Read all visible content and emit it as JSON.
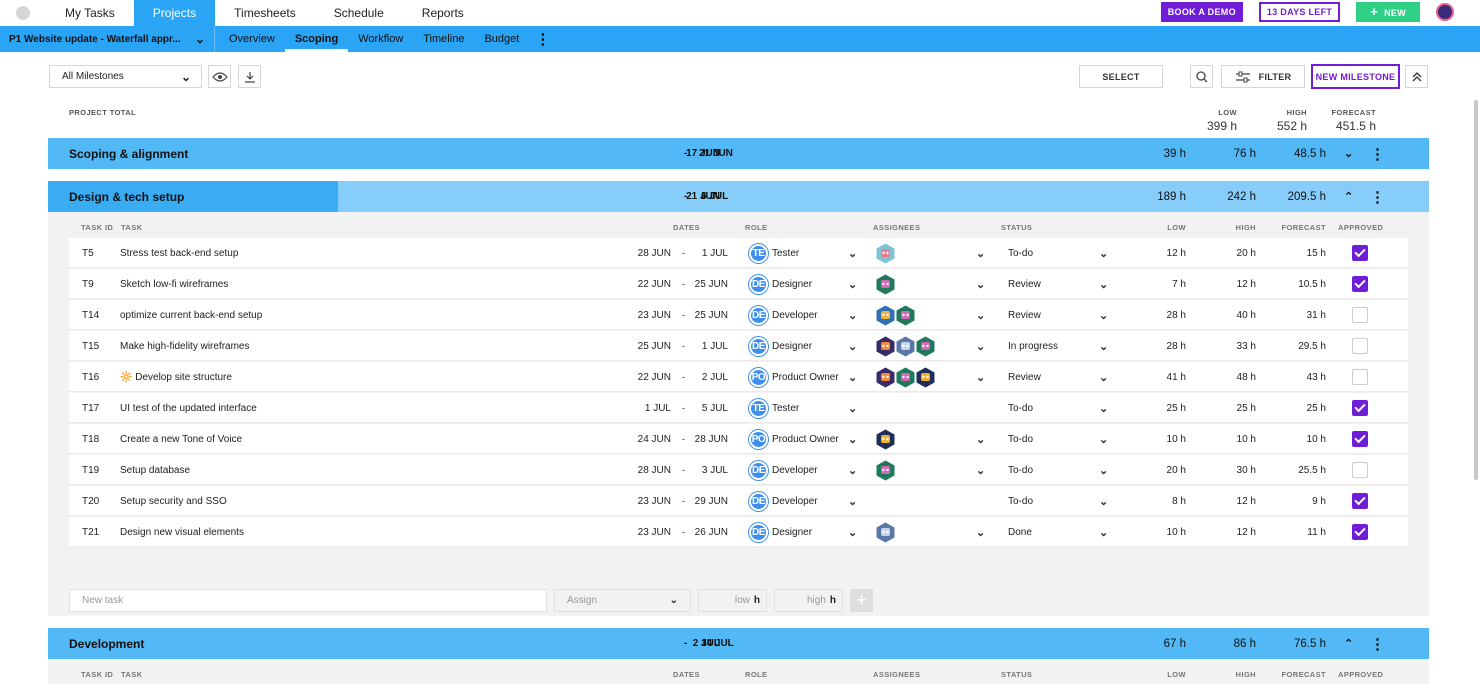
{
  "nav": {
    "items": [
      "My Tasks",
      "Projects",
      "Timesheets",
      "Schedule",
      "Reports"
    ],
    "active_index": 1,
    "book_demo": "BOOK A DEMO",
    "days_left": "13 DAYS LEFT",
    "new": "NEW"
  },
  "subnav": {
    "project": "P1  Website update - Waterfall appr...",
    "tabs": [
      "Overview",
      "Scoping",
      "Workflow",
      "Timeline",
      "Budget"
    ],
    "active_index": 1
  },
  "toolbar": {
    "milestone_filter": "All Milestones",
    "select": "SELECT",
    "filter": "FILTER",
    "new_milestone": "NEW MILESTONE"
  },
  "totals": {
    "label": "PROJECT TOTAL",
    "low_label": "LOW",
    "high_label": "HIGH",
    "forecast_label": "FORECAST",
    "low": "399 h",
    "high": "552 h",
    "forecast": "451.5 h"
  },
  "milestones": [
    {
      "name": "Scoping & alignment",
      "start": "17 JUN",
      "end": "21 JUN",
      "low": "39 h",
      "high": "76 h",
      "forecast": "48.5 h",
      "progress": 1.0
    },
    {
      "name": "Design & tech setup",
      "start": "21 JUN",
      "end": "6 JUL",
      "low": "189 h",
      "high": "242 h",
      "forecast": "209.5 h",
      "progress": 0.21
    },
    {
      "name": "Development",
      "start": "2 JUL",
      "end": "14 JUL",
      "low": "67 h",
      "high": "86 h",
      "forecast": "76.5 h",
      "progress": 1.0
    }
  ],
  "headers": {
    "task_id": "TASK ID",
    "task": "TASK",
    "dates": "DATES",
    "role": "ROLE",
    "assignees": "ASSIGNEES",
    "status": "STATUS",
    "low": "LOW",
    "high": "HIGH",
    "forecast": "FORECAST",
    "approved": "APPROVED"
  },
  "dash": "-",
  "tasks": [
    {
      "id": "T5",
      "task": "Stress test back-end setup",
      "start": "28 JUN",
      "end": "1 JUL",
      "role_abbr": "TE",
      "role": "Tester",
      "assignees": [
        "robot-pink"
      ],
      "status": "To-do",
      "low": "12 h",
      "high": "20 h",
      "forecast": "15 h",
      "approved": true
    },
    {
      "id": "T9",
      "task": "Sketch low-fi wireframes",
      "start": "22 JUN",
      "end": "25 JUN",
      "role_abbr": "DE",
      "role": "Designer",
      "assignees": [
        "robot-green"
      ],
      "status": "Review",
      "low": "7 h",
      "high": "12 h",
      "forecast": "10.5 h",
      "approved": true
    },
    {
      "id": "T14",
      "task": "optimize current back-end setup",
      "start": "23 JUN",
      "end": "25 JUN",
      "role_abbr": "DE",
      "role": "Developer",
      "assignees": [
        "robot-blue",
        "robot-green"
      ],
      "status": "Review",
      "low": "28 h",
      "high": "40 h",
      "forecast": "31 h",
      "approved": false
    },
    {
      "id": "T15",
      "task": "Make high-fidelity wireframes",
      "start": "25 JUN",
      "end": "1 JUL",
      "role_abbr": "DE",
      "role": "Designer",
      "assignees": [
        "robot-purple",
        "robot-grey",
        "robot-green"
      ],
      "status": "In progress",
      "low": "28 h",
      "high": "33 h",
      "forecast": "29.5 h",
      "approved": false
    },
    {
      "id": "T16",
      "task": "🔆 Develop site structure",
      "start": "22 JUN",
      "end": "2 JUL",
      "role_abbr": "PO",
      "role": "Product Owner",
      "assignees": [
        "robot-purple",
        "robot-green",
        "robot-navy"
      ],
      "status": "Review",
      "low": "41 h",
      "high": "48 h",
      "forecast": "43 h",
      "approved": false
    },
    {
      "id": "T17",
      "task": "UI test of the updated interface",
      "start": "1 JUL",
      "end": "5 JUL",
      "role_abbr": "TE",
      "role": "Tester",
      "assignees": [],
      "status": "To-do",
      "low": "25 h",
      "high": "25 h",
      "forecast": "25 h",
      "approved": true
    },
    {
      "id": "T18",
      "task": "Create a new Tone of Voice",
      "start": "24 JUN",
      "end": "28 JUN",
      "role_abbr": "PO",
      "role": "Product Owner",
      "assignees": [
        "robot-navy"
      ],
      "status": "To-do",
      "low": "10 h",
      "high": "10 h",
      "forecast": "10 h",
      "approved": true
    },
    {
      "id": "T19",
      "task": "Setup database",
      "start": "28 JUN",
      "end": "3 JUL",
      "role_abbr": "DE",
      "role": "Developer",
      "assignees": [
        "robot-green"
      ],
      "status": "To-do",
      "low": "20 h",
      "high": "30 h",
      "forecast": "25.5 h",
      "approved": false
    },
    {
      "id": "T20",
      "task": "Setup security and SSO",
      "start": "23 JUN",
      "end": "29 JUN",
      "role_abbr": "DE",
      "role": "Developer",
      "assignees": [],
      "status": "To-do",
      "low": "8 h",
      "high": "12 h",
      "forecast": "9 h",
      "approved": true
    },
    {
      "id": "T21",
      "task": "Design new visual elements",
      "start": "23 JUN",
      "end": "26 JUN",
      "role_abbr": "DE",
      "role": "Designer",
      "assignees": [
        "robot-grey"
      ],
      "status": "Done",
      "low": "10 h",
      "high": "12 h",
      "forecast": "11 h",
      "approved": true
    }
  ],
  "new_task": {
    "placeholder": "New task",
    "assign": "Assign",
    "low": "low",
    "high": "high",
    "unit": "h"
  },
  "colors": {
    "brand_blue": "#2aa4f4",
    "accent_purple": "#6f1ed6",
    "green": "#2fcf86"
  }
}
